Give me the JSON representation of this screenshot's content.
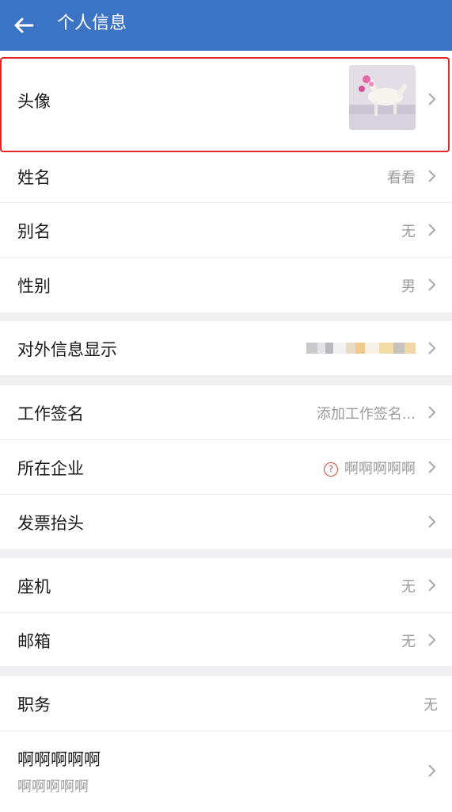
{
  "header": {
    "title": "个人信息",
    "back_icon": "arrow-left-icon"
  },
  "avatar_row": {
    "label": "头像"
  },
  "name_row": {
    "label": "姓名",
    "value": "看看"
  },
  "alias_row": {
    "label": "别名",
    "value": "无"
  },
  "gender_row": {
    "label": "性别",
    "value": "男"
  },
  "external_row": {
    "label": "对外信息显示"
  },
  "signature_row": {
    "label": "工作签名",
    "value": "添加工作签名..."
  },
  "company_row": {
    "label": "所在企业",
    "value": "啊啊啊啊啊"
  },
  "invoice_row": {
    "label": "发票抬头"
  },
  "landline_row": {
    "label": "座机",
    "value": "无"
  },
  "email_row": {
    "label": "邮箱",
    "value": "无"
  },
  "position_row": {
    "label": "职务",
    "value": "无"
  },
  "custom_row": {
    "label": "啊啊啊啊啊",
    "sublabel": "啊啊啊啊啊"
  },
  "colors": {
    "header": "#3b74c4",
    "highlight": "#e02828",
    "background": "#f0f0f2"
  }
}
